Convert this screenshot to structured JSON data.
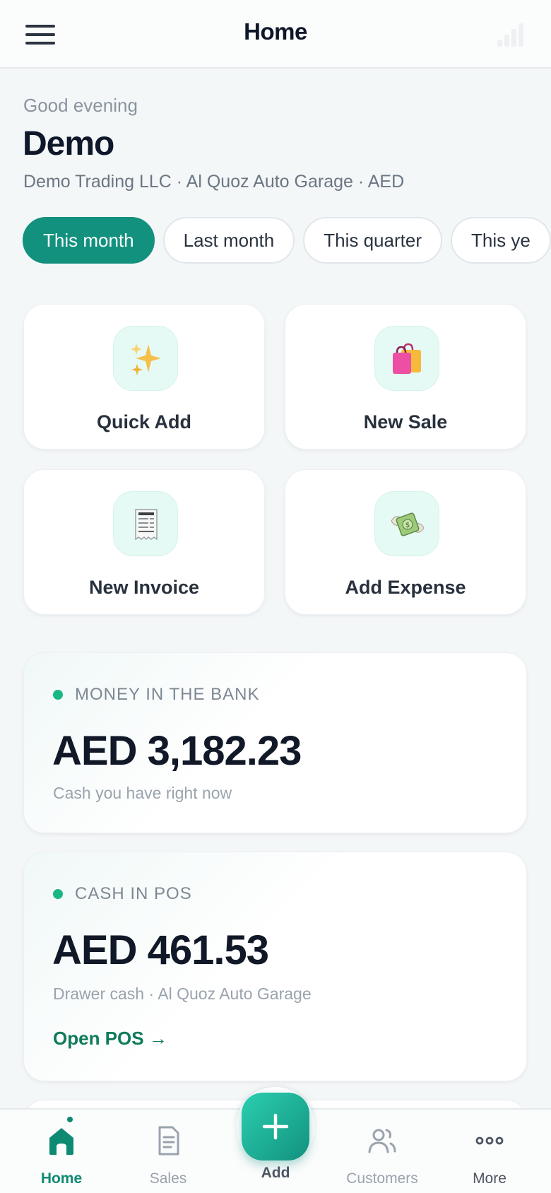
{
  "header": {
    "title": "Home",
    "menu_icon": "hamburger-menu-icon",
    "signal_icon": "signal-bars-icon"
  },
  "greeting": {
    "salutation": "Good evening",
    "name": "Demo",
    "context": "Demo Trading LLC · Al Quoz Auto Garage · AED"
  },
  "periods": [
    {
      "label": "This month",
      "active": true
    },
    {
      "label": "Last month",
      "active": false
    },
    {
      "label": "This quarter",
      "active": false
    },
    {
      "label": "This ye",
      "active": false
    }
  ],
  "actions": [
    {
      "label": "Quick Add",
      "icon": "sparkles-icon"
    },
    {
      "label": "New Sale",
      "icon": "shopping-bags-icon"
    },
    {
      "label": "New Invoice",
      "icon": "receipt-icon"
    },
    {
      "label": "Add Expense",
      "icon": "money-with-wings-icon"
    }
  ],
  "stats": {
    "bank": {
      "caption": "MONEY IN THE BANK",
      "amount": "AED 3,182.23",
      "note": "Cash you have right now"
    },
    "pos": {
      "caption": "CASH IN POS",
      "amount": "AED 461.53",
      "note": "Drawer cash · Al Quoz Auto Garage",
      "link": "Open POS →"
    }
  },
  "colors": {
    "accent": "#12917f",
    "positive_dot": "#19b786",
    "link": "#0f7a5a"
  },
  "bottom_nav": {
    "home": "Home",
    "sales": "Sales",
    "add": "Add",
    "customers": "Customers",
    "more": "More"
  }
}
